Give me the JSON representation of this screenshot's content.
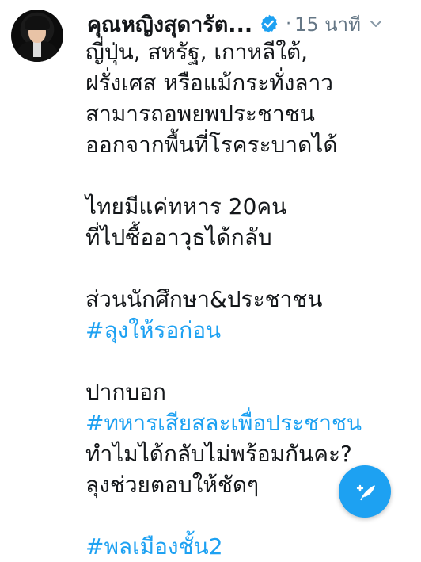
{
  "tweet": {
    "author_name": "คุณหญิงสุดารัต...",
    "verified_icon": "verified-badge-icon",
    "separator": "·",
    "time": "15 นาที",
    "menu_icon": "chevron-down-icon",
    "lines": [
      "ญี่ปุ่น, สหรัฐ, เกาหลีใต้,",
      "ฝรั่งเศส หรือแม้กระทั่งลาว",
      "สามารถอพยพประชาชน",
      "ออกจากพื้นที่โรคระบาดได้",
      "",
      "ไทยมีแค่ทหาร 20คน",
      "ที่ไปซื้ออาวุธได้กลับ",
      "",
      "ส่วนนักศึกษา&ประชาชน",
      "#ลุงให้รอก่อน",
      "",
      "ปากบอก",
      "#ทหารเสียสละเพื่อประชาชน",
      "ทำไมได้กลับไม่พร้อมกันคะ?",
      "ลุงช่วยตอบให้ชัดๆ",
      "",
      "#พลเมืองชั้น2"
    ]
  },
  "compose_button": {
    "icon": "compose-feather-icon"
  },
  "colors": {
    "link": "#1da1f2",
    "text": "#14171a",
    "muted": "#657786",
    "fab": "#1da1f2"
  }
}
